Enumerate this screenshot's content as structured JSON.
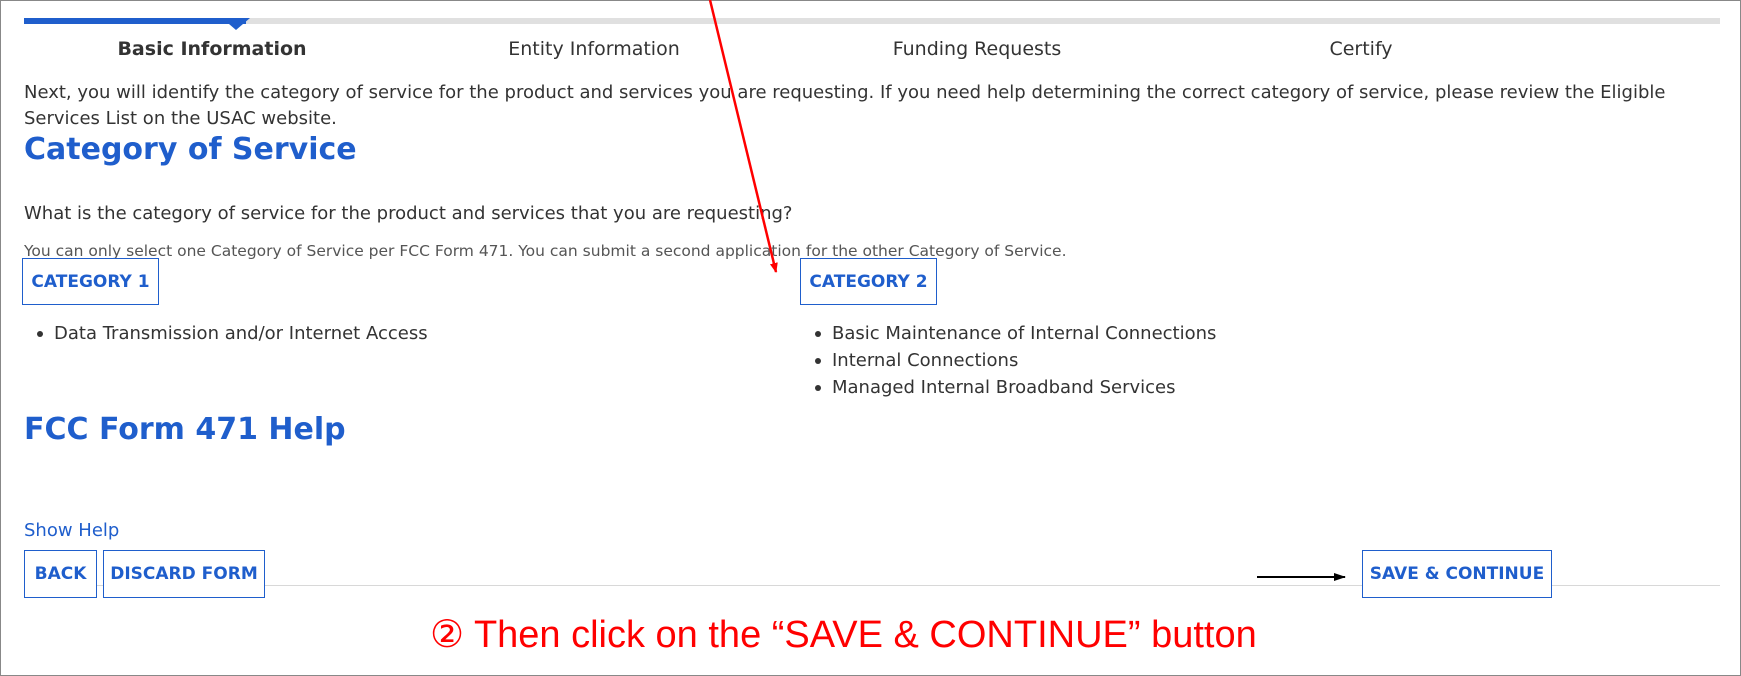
{
  "steps": [
    {
      "label": "Basic Information",
      "active": true
    },
    {
      "label": "Entity Information",
      "active": false
    },
    {
      "label": "Funding Requests",
      "active": false
    },
    {
      "label": "Certify",
      "active": false
    }
  ],
  "intro_text": "Next, you will identify the category of service for the product and services you are requesting. If you need help determining the correct category of service, please review the Eligible Services List on the USAC website.",
  "category_section": {
    "heading": "Category of Service",
    "question": "What is the category of service for the product and services that you are requesting?",
    "note": "You can only select one Category of Service per FCC Form 471. You can submit a second application for the other Category of Service.",
    "category1": {
      "button_label": "CATEGORY 1",
      "items": [
        "Data Transmission and/or Internet Access"
      ]
    },
    "category2": {
      "button_label": "CATEGORY 2",
      "items": [
        "Basic Maintenance of Internal Connections",
        "Internal Connections",
        "Managed Internal Broadband Services"
      ]
    }
  },
  "help_section": {
    "heading": "FCC Form 471 Help",
    "link": "Show Help"
  },
  "footer": {
    "back_label": "BACK",
    "discard_label": "DISCARD FORM",
    "save_continue_label": "SAVE & CONTINUE"
  },
  "annotation": {
    "text": "② Then click on the “SAVE & CONTINUE” button",
    "color": "#ff0000"
  },
  "colors": {
    "accent": "#1f5ecc",
    "text": "#333333",
    "annotation": "#ff0000"
  }
}
